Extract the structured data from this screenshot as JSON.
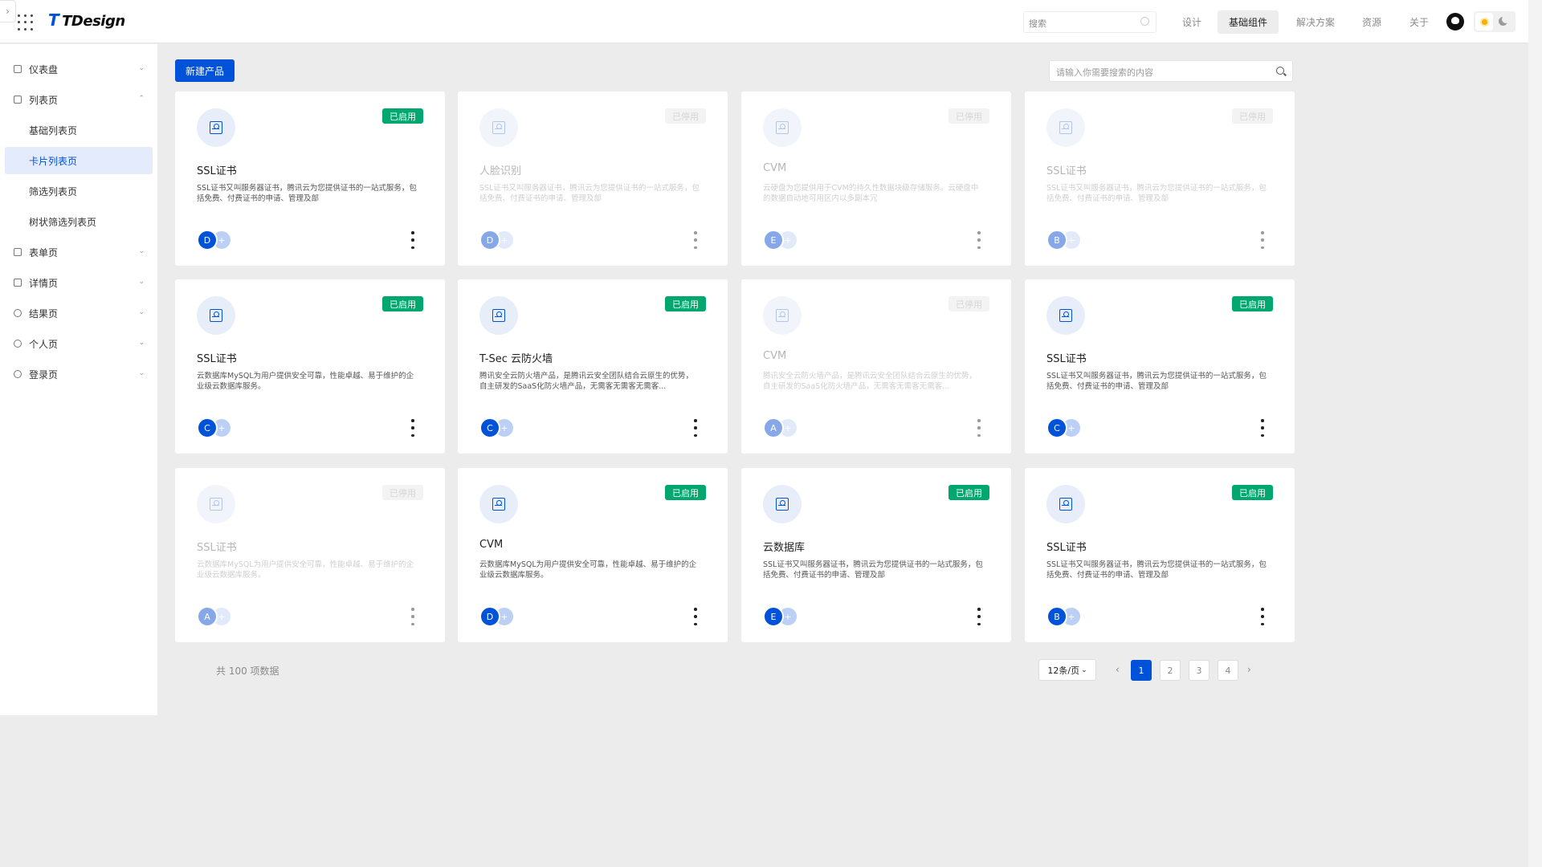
{
  "header": {
    "logo_text": "TDesign",
    "search_placeholder": "搜索",
    "nav": [
      "设计",
      "基础组件",
      "解决方案",
      "资源",
      "关于"
    ],
    "active_nav": "基础组件"
  },
  "sidebar": {
    "items": [
      {
        "label": "仪表盘"
      },
      {
        "label": "列表页"
      },
      {
        "label": "基础列表页"
      },
      {
        "label": "卡片列表页"
      },
      {
        "label": "筛选列表页"
      },
      {
        "label": "树状筛选列表页"
      },
      {
        "label": "表单页"
      },
      {
        "label": "详情页"
      },
      {
        "label": "结果页"
      },
      {
        "label": "个人页"
      },
      {
        "label": "登录页"
      }
    ],
    "active": "卡片列表页"
  },
  "toolbar": {
    "new_button": "新建产品",
    "search_placeholder": "请输入你需要搜索的内容"
  },
  "cards": [
    {
      "title": "SSL证书",
      "desc": "SSL证书又叫服务器证书，腾讯云为您提供证书的一站式服务，包括免费、付费证书的申请、管理及部",
      "status": "已启用",
      "enabled": true,
      "avatar": "D"
    },
    {
      "title": "人脸识别",
      "desc": "SSL证书又叫服务器证书，腾讯云为您提供证书的一站式服务，包括免费、付费证书的申请、管理及部",
      "status": "已停用",
      "enabled": false,
      "avatar": "D"
    },
    {
      "title": "CVM",
      "desc": "云硬盘为您提供用于CVM的持久性数据块级存储服务。云硬盘中的数据自动地可用区内以多副本冗",
      "status": "已停用",
      "enabled": false,
      "avatar": "E"
    },
    {
      "title": "SSL证书",
      "desc": "SSL证书又叫服务器证书，腾讯云为您提供证书的一站式服务，包括免费、付费证书的申请、管理及部",
      "status": "已停用",
      "enabled": false,
      "avatar": "B"
    },
    {
      "title": "SSL证书",
      "desc": "云数据库MySQL为用户提供安全可靠，性能卓越、易于维护的企业级云数据库服务。",
      "status": "已启用",
      "enabled": true,
      "avatar": "C"
    },
    {
      "title": "T-Sec 云防火墙",
      "desc": "腾讯安全云防火墙产品，是腾讯云安全团队结合云原生的优势，自主研发的SaaS化防火墙产品，无需客无需客无需客...",
      "status": "已启用",
      "enabled": true,
      "avatar": "C"
    },
    {
      "title": "CVM",
      "desc": "腾讯安全云防火墙产品，是腾讯云安全团队结合云原生的优势，自主研发的SaaS化防火墙产品，无需客无需客无需客...",
      "status": "已停用",
      "enabled": false,
      "avatar": "A"
    },
    {
      "title": "SSL证书",
      "desc": "SSL证书又叫服务器证书，腾讯云为您提供证书的一站式服务，包括免费、付费证书的申请、管理及部",
      "status": "已启用",
      "enabled": true,
      "avatar": "C"
    },
    {
      "title": "SSL证书",
      "desc": "云数据库MySQL为用户提供安全可靠，性能卓越、易于维护的企业级云数据库服务。",
      "status": "已停用",
      "enabled": false,
      "avatar": "A"
    },
    {
      "title": "CVM",
      "desc": "云数据库MySQL为用户提供安全可靠，性能卓越、易于维护的企业级云数据库服务。",
      "status": "已启用",
      "enabled": true,
      "avatar": "D"
    },
    {
      "title": "云数据库",
      "desc": "SSL证书又叫服务器证书，腾讯云为您提供证书的一站式服务，包括免费、付费证书的申请、管理及部",
      "status": "已启用",
      "enabled": true,
      "avatar": "E"
    },
    {
      "title": "SSL证书",
      "desc": "SSL证书又叫服务器证书，腾讯云为您提供证书的一站式服务，包括免费、付费证书的申请、管理及部",
      "status": "已启用",
      "enabled": true,
      "avatar": "B"
    }
  ],
  "avatar_add": "+",
  "pagination": {
    "total_text": "共 100 项数据",
    "page_size": "12条/页",
    "pages": [
      "1",
      "2",
      "3",
      "4"
    ],
    "current": "1",
    "prev": "‹",
    "next": "›"
  },
  "colors": {
    "primary": "#0052d9",
    "success": "#00a870",
    "background": "#ececec"
  }
}
